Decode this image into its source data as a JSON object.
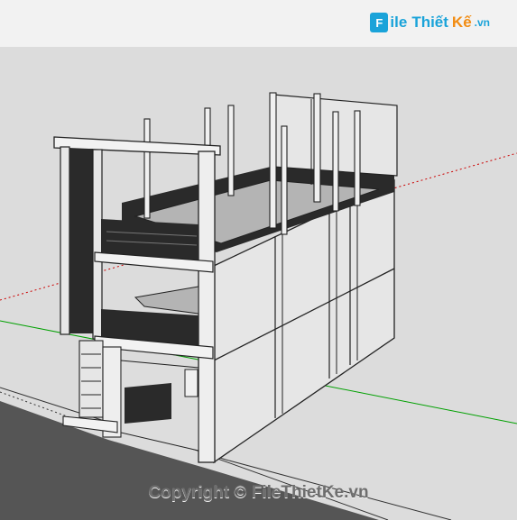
{
  "header": {
    "logo_box_text": "F",
    "logo_text_file": "ile",
    "logo_text_thiet": "Thiết",
    "logo_text_ke": "Kế",
    "logo_text_vn": ".vn"
  },
  "viewport": {
    "model": "two-storey townhouse 3D model",
    "axes": {
      "x_axis_color": "#cc0000",
      "y_axis_color": "#00a000"
    },
    "colors": {
      "background": "#dcdcdc",
      "wall": "#e6e6e6",
      "floor": "#b4b4b4",
      "railing": "#2a2a2a",
      "road": "#555555",
      "header": "#f2f2f2"
    }
  },
  "footer": {
    "copyright": "Copyright © FileThietKe.vn"
  }
}
